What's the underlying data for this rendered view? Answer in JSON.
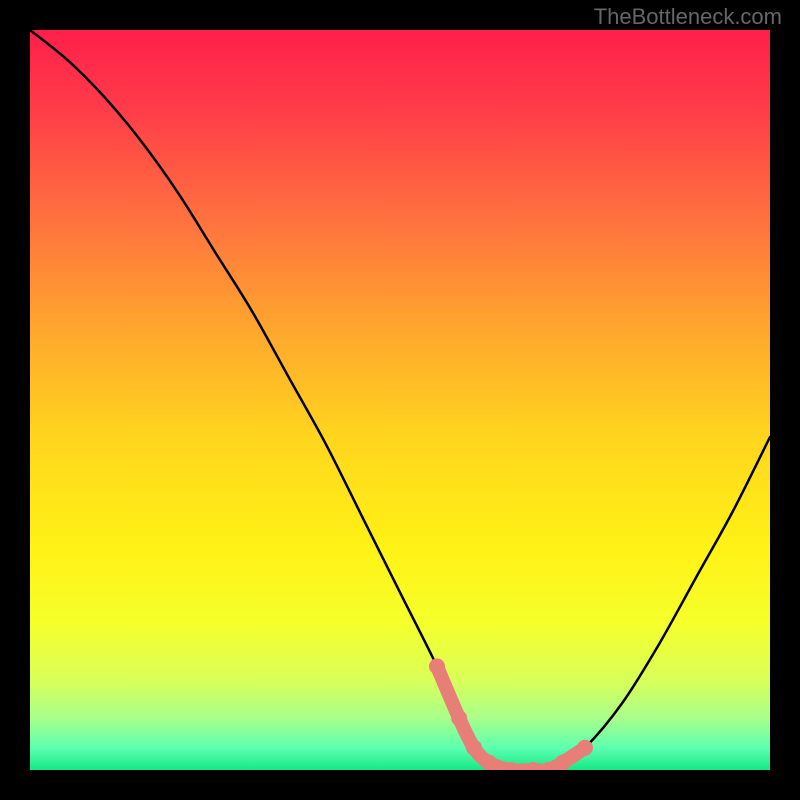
{
  "watermark": "TheBottleneck.com",
  "chart_data": {
    "type": "line",
    "title": "",
    "xlabel": "",
    "ylabel": "",
    "xlim": [
      0,
      100
    ],
    "ylim": [
      0,
      100
    ],
    "series": [
      {
        "name": "bottleneck-curve",
        "x": [
          0,
          5,
          10,
          15,
          20,
          25,
          30,
          35,
          40,
          45,
          50,
          55,
          58,
          60,
          62,
          65,
          68,
          70,
          72,
          75,
          80,
          85,
          90,
          95,
          100
        ],
        "y": [
          100,
          96,
          91,
          85,
          78,
          70,
          62,
          53,
          44,
          34,
          24,
          14,
          7,
          3,
          1,
          0,
          0,
          0,
          1,
          3,
          9,
          17,
          26,
          35,
          45
        ]
      }
    ],
    "highlight": {
      "name": "optimal-region",
      "color": "#e77f78",
      "x": [
        55,
        58,
        60,
        62,
        65,
        68,
        70,
        72,
        75
      ],
      "y": [
        14,
        7,
        3,
        1,
        0,
        0,
        0,
        1,
        3
      ]
    },
    "background_gradient": {
      "stops": [
        {
          "offset": 0,
          "color": "#ff1f4b"
        },
        {
          "offset": 0.1,
          "color": "#ff3a49"
        },
        {
          "offset": 0.25,
          "color": "#ff6f3f"
        },
        {
          "offset": 0.4,
          "color": "#ffa52e"
        },
        {
          "offset": 0.55,
          "color": "#ffd51e"
        },
        {
          "offset": 0.7,
          "color": "#fff215"
        },
        {
          "offset": 0.8,
          "color": "#f6ff2a"
        },
        {
          "offset": 0.88,
          "color": "#d9ff5a"
        },
        {
          "offset": 0.93,
          "color": "#a8ff8a"
        },
        {
          "offset": 0.97,
          "color": "#5dffb0"
        },
        {
          "offset": 1.0,
          "color": "#16e887"
        }
      ]
    }
  }
}
